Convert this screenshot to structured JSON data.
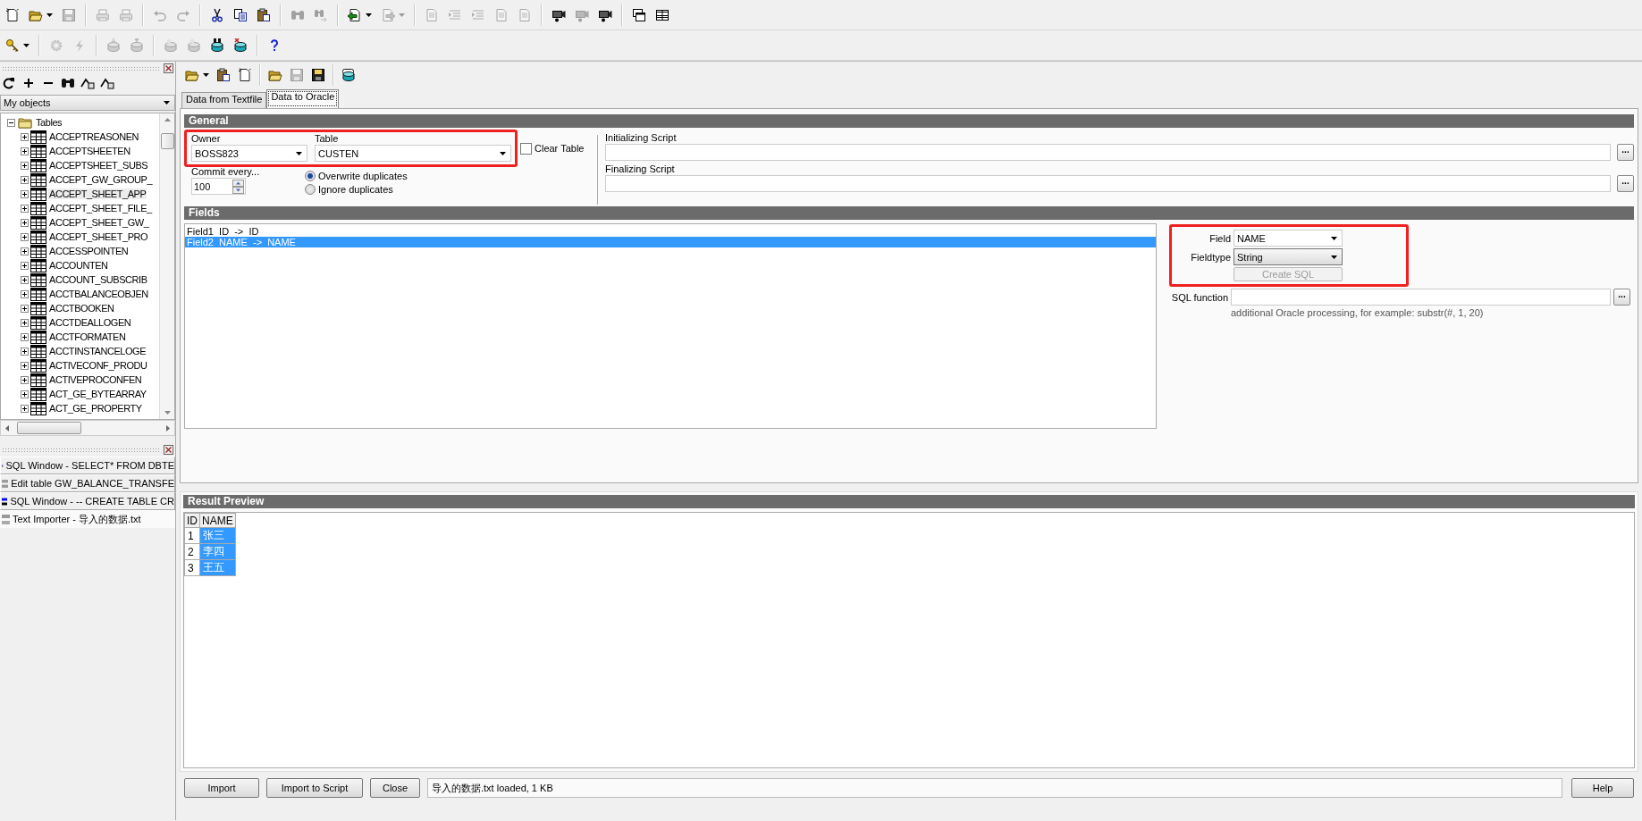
{
  "main_toolbar": [
    {
      "kind": "new",
      "disabled": false
    },
    {
      "kind": "open",
      "disabled": false,
      "dropdown": true
    },
    {
      "kind": "save",
      "disabled": true
    },
    {
      "kind": "separator"
    },
    {
      "kind": "print",
      "disabled": true
    },
    {
      "kind": "print",
      "disabled": true
    },
    {
      "kind": "separator"
    },
    {
      "kind": "undo",
      "disabled": true
    },
    {
      "kind": "redo",
      "disabled": true
    },
    {
      "kind": "separator"
    },
    {
      "kind": "cut",
      "disabled": false
    },
    {
      "kind": "copy",
      "disabled": false
    },
    {
      "kind": "paste",
      "disabled": false
    },
    {
      "kind": "separator"
    },
    {
      "kind": "find",
      "disabled": true
    },
    {
      "kind": "findnext",
      "disabled": true
    },
    {
      "kind": "separator"
    },
    {
      "kind": "import",
      "disabled": false,
      "dropdown": true
    },
    {
      "kind": "export",
      "disabled": true,
      "dropdown": true
    },
    {
      "kind": "separator"
    },
    {
      "kind": "doc",
      "disabled": true
    },
    {
      "kind": "indent",
      "disabled": true
    },
    {
      "kind": "indent",
      "disabled": true
    },
    {
      "kind": "doc",
      "disabled": true
    },
    {
      "kind": "doc",
      "disabled": true
    },
    {
      "kind": "separator"
    },
    {
      "kind": "camera",
      "disabled": false
    },
    {
      "kind": "camera",
      "disabled": true
    },
    {
      "kind": "camera",
      "disabled": false
    },
    {
      "kind": "separator"
    },
    {
      "kind": "windows",
      "disabled": false
    },
    {
      "kind": "tile",
      "disabled": false
    }
  ],
  "secondary_toolbar": [
    {
      "kind": "key",
      "disabled": false,
      "dropdown": true
    },
    {
      "kind": "separator"
    },
    {
      "kind": "gear",
      "disabled": true
    },
    {
      "kind": "bolt",
      "disabled": true
    },
    {
      "kind": "separator"
    },
    {
      "kind": "dbdown",
      "disabled": true
    },
    {
      "kind": "dbup",
      "disabled": true
    },
    {
      "kind": "separator"
    },
    {
      "kind": "dbsql",
      "disabled": true
    },
    {
      "kind": "dbsql",
      "disabled": true
    },
    {
      "kind": "dbfind",
      "disabled": false
    },
    {
      "kind": "dbx",
      "disabled": false
    },
    {
      "kind": "separator"
    },
    {
      "kind": "help",
      "disabled": false
    }
  ],
  "object_browser": {
    "tools": [
      {
        "kind": "refresh",
        "disabled": false
      },
      {
        "kind": "plus",
        "disabled": false
      },
      {
        "kind": "minus",
        "disabled": false
      },
      {
        "kind": "find",
        "disabled": false
      },
      {
        "kind": "filter",
        "disabled": false
      },
      {
        "kind": "filter",
        "disabled": false
      }
    ],
    "filter": "My objects",
    "tree": [
      {
        "label": "Tables",
        "expanded": true,
        "selected": false,
        "children": [
          {
            "label": "ACCEPTREASONEN",
            "expanded": false,
            "selected": false
          },
          {
            "label": "ACCEPTSHEETEN",
            "expanded": false,
            "selected": false
          },
          {
            "label": "ACCEPTSHEET_SUBS",
            "expanded": false,
            "selected": false
          },
          {
            "label": "ACCEPT_GW_GROUP_",
            "expanded": false,
            "selected": false
          },
          {
            "label": "ACCEPT_SHEET_APP",
            "expanded": false,
            "selected": true
          },
          {
            "label": "ACCEPT_SHEET_FILE_",
            "expanded": false,
            "selected": false
          },
          {
            "label": "ACCEPT_SHEET_GW_",
            "expanded": false,
            "selected": false
          },
          {
            "label": "ACCEPT_SHEET_PRO",
            "expanded": false,
            "selected": false
          },
          {
            "label": "ACCESSPOINTEN",
            "expanded": false,
            "selected": false
          },
          {
            "label": "ACCOUNTEN",
            "expanded": false,
            "selected": false
          },
          {
            "label": "ACCOUNT_SUBSCRIB",
            "expanded": false,
            "selected": false
          },
          {
            "label": "ACCTBALANCEOBJEN",
            "expanded": false,
            "selected": false
          },
          {
            "label": "ACCTBOOKEN",
            "expanded": false,
            "selected": false
          },
          {
            "label": "ACCTDEALLOGEN",
            "expanded": false,
            "selected": false
          },
          {
            "label": "ACCTFORMATEN",
            "expanded": false,
            "selected": false
          },
          {
            "label": "ACCTINSTANCELOGE",
            "expanded": false,
            "selected": false
          },
          {
            "label": "ACTIVECONF_PRODU",
            "expanded": false,
            "selected": false
          },
          {
            "label": "ACTIVEPROCONFEN",
            "expanded": false,
            "selected": false
          },
          {
            "label": "ACT_GE_BYTEARRAY",
            "expanded": false,
            "selected": false
          },
          {
            "label": "ACT_GE_PROPERTY",
            "expanded": false,
            "selected": false
          }
        ]
      }
    ],
    "windows": [
      {
        "kind": "sql",
        "label": "SQL Window - SELECT* FROM DBTE",
        "selected": false
      },
      {
        "kind": "edit",
        "label": "Edit table GW_BALANCE_TRANSFE",
        "selected": false
      },
      {
        "kind": "sql",
        "label": "SQL Window - -- CREATE TABLE CR",
        "selected": false
      },
      {
        "kind": "importer",
        "label": "Text Importer - 导入的数据.txt",
        "selected": true
      }
    ]
  },
  "importer": {
    "toolbar": [
      {
        "kind": "open",
        "disabled": false,
        "dropdown": true
      },
      {
        "kind": "paste",
        "disabled": false
      },
      {
        "kind": "new",
        "disabled": false
      },
      {
        "kind": "separator"
      },
      {
        "kind": "open",
        "disabled": false
      },
      {
        "kind": "save",
        "disabled": true
      },
      {
        "kind": "savecolor",
        "disabled": false
      },
      {
        "kind": "separator"
      },
      {
        "kind": "dbcopy",
        "disabled": false
      }
    ],
    "tabs": [
      {
        "label": "Data from Textfile",
        "selected": false
      },
      {
        "label": "Data to Oracle",
        "selected": true
      }
    ],
    "general": {
      "title": "General",
      "owner_label": "Owner",
      "owner": "BOSS823",
      "table_label": "Table",
      "table": "CUSTEN",
      "clear_table": {
        "label": "Clear Table",
        "checked": false
      },
      "commit_label": "Commit every...",
      "commit": "100",
      "duplicates": [
        {
          "label": "Overwrite duplicates",
          "selected": true
        },
        {
          "label": "Ignore duplicates",
          "selected": false
        }
      ],
      "init_label": "Initializing Script",
      "init_button": "...",
      "final_label": "Finalizing Script",
      "final_button": "..."
    },
    "fields": {
      "title": "Fields",
      "list": [
        {
          "label": "Field1  ID  ->  ID",
          "selected": false
        },
        {
          "label": "Field2  NAME  ->  NAME",
          "selected": true
        }
      ],
      "field_label": "Field",
      "field": "NAME",
      "fieldtype_label": "Fieldtype",
      "fieldtype": "String",
      "create_sql": {
        "label": "Create SQL",
        "disabled": true
      },
      "sql_function_label": "SQL function",
      "sql_function_button": "...",
      "hint": "additional Oracle processing, for example: substr(#, 1, 20)"
    },
    "result": {
      "title": "Result Preview",
      "columns": [
        {
          "label": "ID",
          "selected": false
        },
        {
          "label": "NAME",
          "selected": true
        }
      ],
      "rows": [
        [
          "1",
          "张三"
        ],
        [
          "2",
          "李四"
        ],
        [
          "3",
          "王五"
        ]
      ]
    },
    "buttons": [
      {
        "label": "Import"
      },
      {
        "label": "Import to Script"
      },
      {
        "label": "Close"
      }
    ],
    "status": "导入的数据.txt loaded, 1 KB",
    "help": "Help"
  }
}
